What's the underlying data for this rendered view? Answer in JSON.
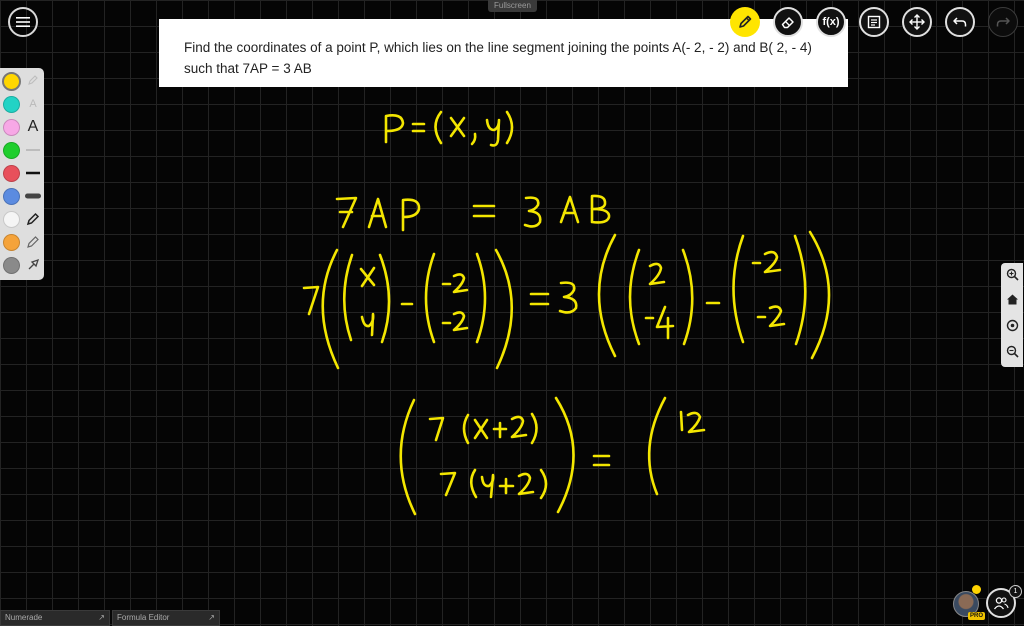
{
  "header": {
    "mode_label": "Fullscreen",
    "question_text": "Find the coordinates of a point P, which lies on the line segment joining the points A(- 2, - 2) and B( 2, - 4) such that 7AP = 3 AB"
  },
  "toolbar": {
    "formula_label": "f(x)"
  },
  "palette": {
    "text_tool_small": "A",
    "text_tool_large": "A",
    "colors": [
      "#ffd600",
      "#22d3c5",
      "#f7a8e6",
      "#1fce2d",
      "#e8505b",
      "#5b8be0",
      "#f5f5f5",
      "#f5a33a",
      "#8a8a8a"
    ]
  },
  "bottom": {
    "tab_left_label": "Numerade",
    "tab_right_label": "Formula Editor",
    "pro_label": "PRO",
    "participant_count": "1"
  },
  "colors": {
    "ink": "#f3e600",
    "accent": "#ffe500"
  }
}
